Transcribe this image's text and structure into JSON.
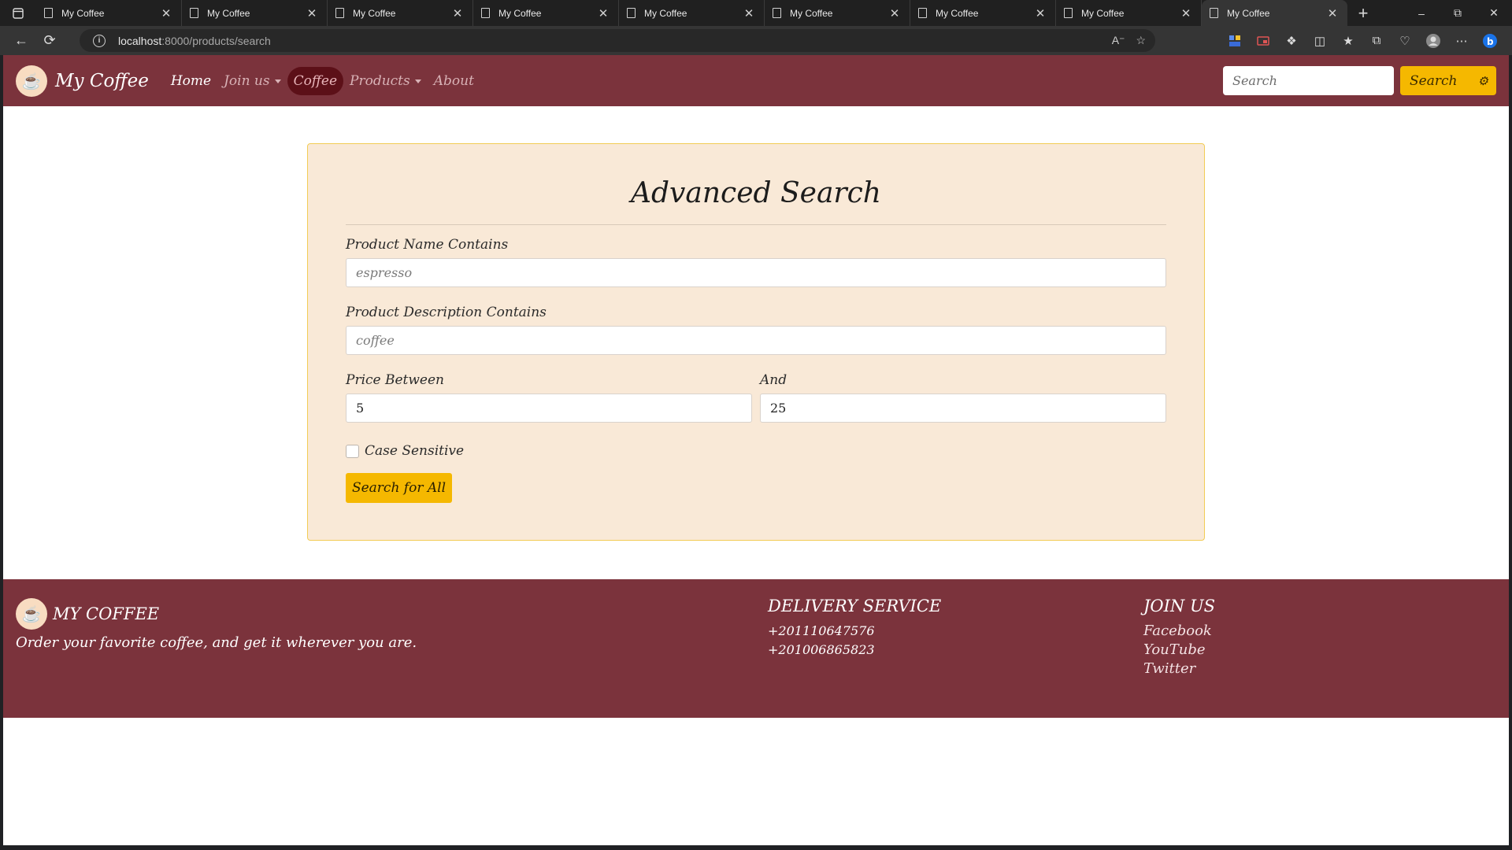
{
  "browser": {
    "tabs": [
      {
        "title": "My Coffee",
        "active": false
      },
      {
        "title": "My Coffee",
        "active": false
      },
      {
        "title": "My Coffee",
        "active": false
      },
      {
        "title": "My Coffee",
        "active": false
      },
      {
        "title": "My Coffee",
        "active": false
      },
      {
        "title": "My Coffee",
        "active": false
      },
      {
        "title": "My Coffee",
        "active": false
      },
      {
        "title": "My Coffee",
        "active": false
      },
      {
        "title": "My Coffee",
        "active": true
      }
    ],
    "url_host": "localhost",
    "url_path": ":8000/products/search"
  },
  "navbar": {
    "brand": "My Coffee",
    "links": {
      "home": "Home",
      "join_us": "Join us",
      "coffee": "Coffee",
      "products": "Products",
      "about": "About"
    },
    "search_placeholder": "Search",
    "search_button": "Search"
  },
  "form": {
    "title": "Advanced Search",
    "name_label": "Product Name Contains",
    "name_placeholder": "espresso",
    "desc_label": "Product Description Contains",
    "desc_placeholder": "coffee",
    "price_min_label": "Price Between",
    "price_min_value": "5",
    "price_max_label": "And",
    "price_max_value": "25",
    "case_sensitive_label": "Case Sensitive",
    "case_sensitive_checked": false,
    "submit_label": "Search for All"
  },
  "footer": {
    "brand": "MY COFFEE",
    "tagline": "Order your favorite coffee, and get it wherever you are.",
    "delivery_title": "DELIVERY SERVICE",
    "phones": [
      "+201110647576",
      "+201006865823"
    ],
    "join_title": "JOIN US",
    "social": [
      "Facebook",
      "YouTube",
      "Twitter"
    ]
  },
  "colors": {
    "brand_maroon": "#7b333c",
    "accent_yellow": "#f5b800",
    "card_bg": "#f9e9d7"
  }
}
